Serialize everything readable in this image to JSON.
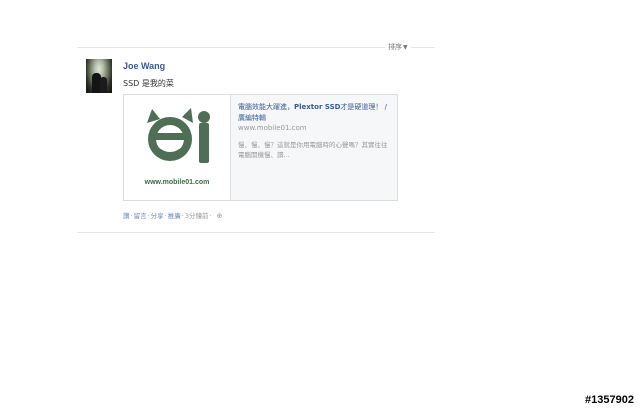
{
  "feed": {
    "sort_label": "排序",
    "post": {
      "author": "Joe Wang",
      "message": "SSD 是我的菜",
      "link_card": {
        "title_part1": "電腦效能大躍進，",
        "title_bold": "Plextor SSD",
        "title_part2": "才是硬道理！ / 廣編特輯",
        "domain": "www.mobile01.com",
        "description": "慢、慢、慢？這就是你用電腦時的心聲嗎？其實往往電腦開機慢、讀...",
        "thumbnail_caption": "www.mobile01.com"
      },
      "actions": {
        "like": "讚",
        "comment": "留言",
        "share": "分享",
        "promote": "推廣",
        "time": "3分鐘前"
      }
    }
  },
  "watermark": "#1357902",
  "icons": {
    "sort_caret": "chevron-down-icon",
    "privacy": "globe-icon",
    "logo": "mobile01-logo"
  },
  "colors": {
    "link": "#3b5998",
    "logo_green": "#4e6e55",
    "muted": "#999999"
  }
}
